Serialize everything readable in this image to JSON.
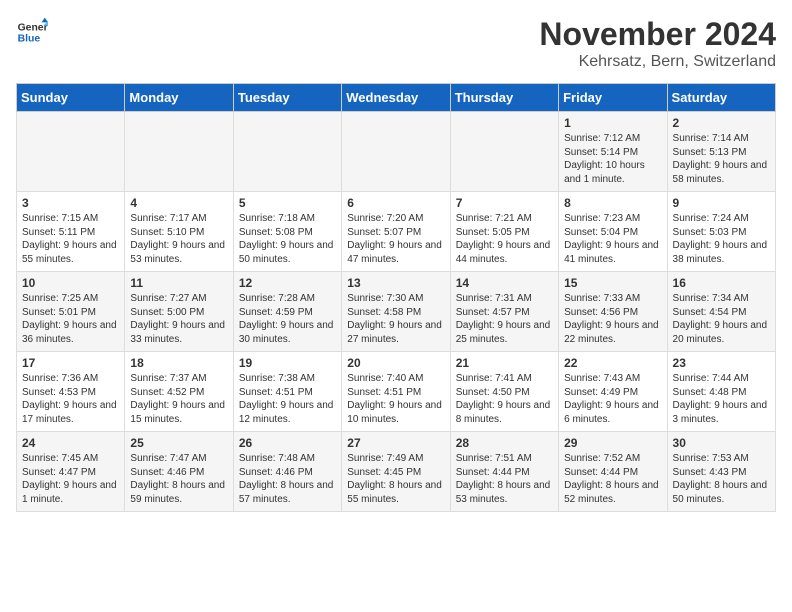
{
  "header": {
    "logo_general": "General",
    "logo_blue": "Blue",
    "title": "November 2024",
    "subtitle": "Kehrsatz, Bern, Switzerland"
  },
  "days_of_week": [
    "Sunday",
    "Monday",
    "Tuesday",
    "Wednesday",
    "Thursday",
    "Friday",
    "Saturday"
  ],
  "weeks": [
    [
      {
        "day": "",
        "info": ""
      },
      {
        "day": "",
        "info": ""
      },
      {
        "day": "",
        "info": ""
      },
      {
        "day": "",
        "info": ""
      },
      {
        "day": "",
        "info": ""
      },
      {
        "day": "1",
        "info": "Sunrise: 7:12 AM\nSunset: 5:14 PM\nDaylight: 10 hours and 1 minute."
      },
      {
        "day": "2",
        "info": "Sunrise: 7:14 AM\nSunset: 5:13 PM\nDaylight: 9 hours and 58 minutes."
      }
    ],
    [
      {
        "day": "3",
        "info": "Sunrise: 7:15 AM\nSunset: 5:11 PM\nDaylight: 9 hours and 55 minutes."
      },
      {
        "day": "4",
        "info": "Sunrise: 7:17 AM\nSunset: 5:10 PM\nDaylight: 9 hours and 53 minutes."
      },
      {
        "day": "5",
        "info": "Sunrise: 7:18 AM\nSunset: 5:08 PM\nDaylight: 9 hours and 50 minutes."
      },
      {
        "day": "6",
        "info": "Sunrise: 7:20 AM\nSunset: 5:07 PM\nDaylight: 9 hours and 47 minutes."
      },
      {
        "day": "7",
        "info": "Sunrise: 7:21 AM\nSunset: 5:05 PM\nDaylight: 9 hours and 44 minutes."
      },
      {
        "day": "8",
        "info": "Sunrise: 7:23 AM\nSunset: 5:04 PM\nDaylight: 9 hours and 41 minutes."
      },
      {
        "day": "9",
        "info": "Sunrise: 7:24 AM\nSunset: 5:03 PM\nDaylight: 9 hours and 38 minutes."
      }
    ],
    [
      {
        "day": "10",
        "info": "Sunrise: 7:25 AM\nSunset: 5:01 PM\nDaylight: 9 hours and 36 minutes."
      },
      {
        "day": "11",
        "info": "Sunrise: 7:27 AM\nSunset: 5:00 PM\nDaylight: 9 hours and 33 minutes."
      },
      {
        "day": "12",
        "info": "Sunrise: 7:28 AM\nSunset: 4:59 PM\nDaylight: 9 hours and 30 minutes."
      },
      {
        "day": "13",
        "info": "Sunrise: 7:30 AM\nSunset: 4:58 PM\nDaylight: 9 hours and 27 minutes."
      },
      {
        "day": "14",
        "info": "Sunrise: 7:31 AM\nSunset: 4:57 PM\nDaylight: 9 hours and 25 minutes."
      },
      {
        "day": "15",
        "info": "Sunrise: 7:33 AM\nSunset: 4:56 PM\nDaylight: 9 hours and 22 minutes."
      },
      {
        "day": "16",
        "info": "Sunrise: 7:34 AM\nSunset: 4:54 PM\nDaylight: 9 hours and 20 minutes."
      }
    ],
    [
      {
        "day": "17",
        "info": "Sunrise: 7:36 AM\nSunset: 4:53 PM\nDaylight: 9 hours and 17 minutes."
      },
      {
        "day": "18",
        "info": "Sunrise: 7:37 AM\nSunset: 4:52 PM\nDaylight: 9 hours and 15 minutes."
      },
      {
        "day": "19",
        "info": "Sunrise: 7:38 AM\nSunset: 4:51 PM\nDaylight: 9 hours and 12 minutes."
      },
      {
        "day": "20",
        "info": "Sunrise: 7:40 AM\nSunset: 4:51 PM\nDaylight: 9 hours and 10 minutes."
      },
      {
        "day": "21",
        "info": "Sunrise: 7:41 AM\nSunset: 4:50 PM\nDaylight: 9 hours and 8 minutes."
      },
      {
        "day": "22",
        "info": "Sunrise: 7:43 AM\nSunset: 4:49 PM\nDaylight: 9 hours and 6 minutes."
      },
      {
        "day": "23",
        "info": "Sunrise: 7:44 AM\nSunset: 4:48 PM\nDaylight: 9 hours and 3 minutes."
      }
    ],
    [
      {
        "day": "24",
        "info": "Sunrise: 7:45 AM\nSunset: 4:47 PM\nDaylight: 9 hours and 1 minute."
      },
      {
        "day": "25",
        "info": "Sunrise: 7:47 AM\nSunset: 4:46 PM\nDaylight: 8 hours and 59 minutes."
      },
      {
        "day": "26",
        "info": "Sunrise: 7:48 AM\nSunset: 4:46 PM\nDaylight: 8 hours and 57 minutes."
      },
      {
        "day": "27",
        "info": "Sunrise: 7:49 AM\nSunset: 4:45 PM\nDaylight: 8 hours and 55 minutes."
      },
      {
        "day": "28",
        "info": "Sunrise: 7:51 AM\nSunset: 4:44 PM\nDaylight: 8 hours and 53 minutes."
      },
      {
        "day": "29",
        "info": "Sunrise: 7:52 AM\nSunset: 4:44 PM\nDaylight: 8 hours and 52 minutes."
      },
      {
        "day": "30",
        "info": "Sunrise: 7:53 AM\nSunset: 4:43 PM\nDaylight: 8 hours and 50 minutes."
      }
    ]
  ]
}
